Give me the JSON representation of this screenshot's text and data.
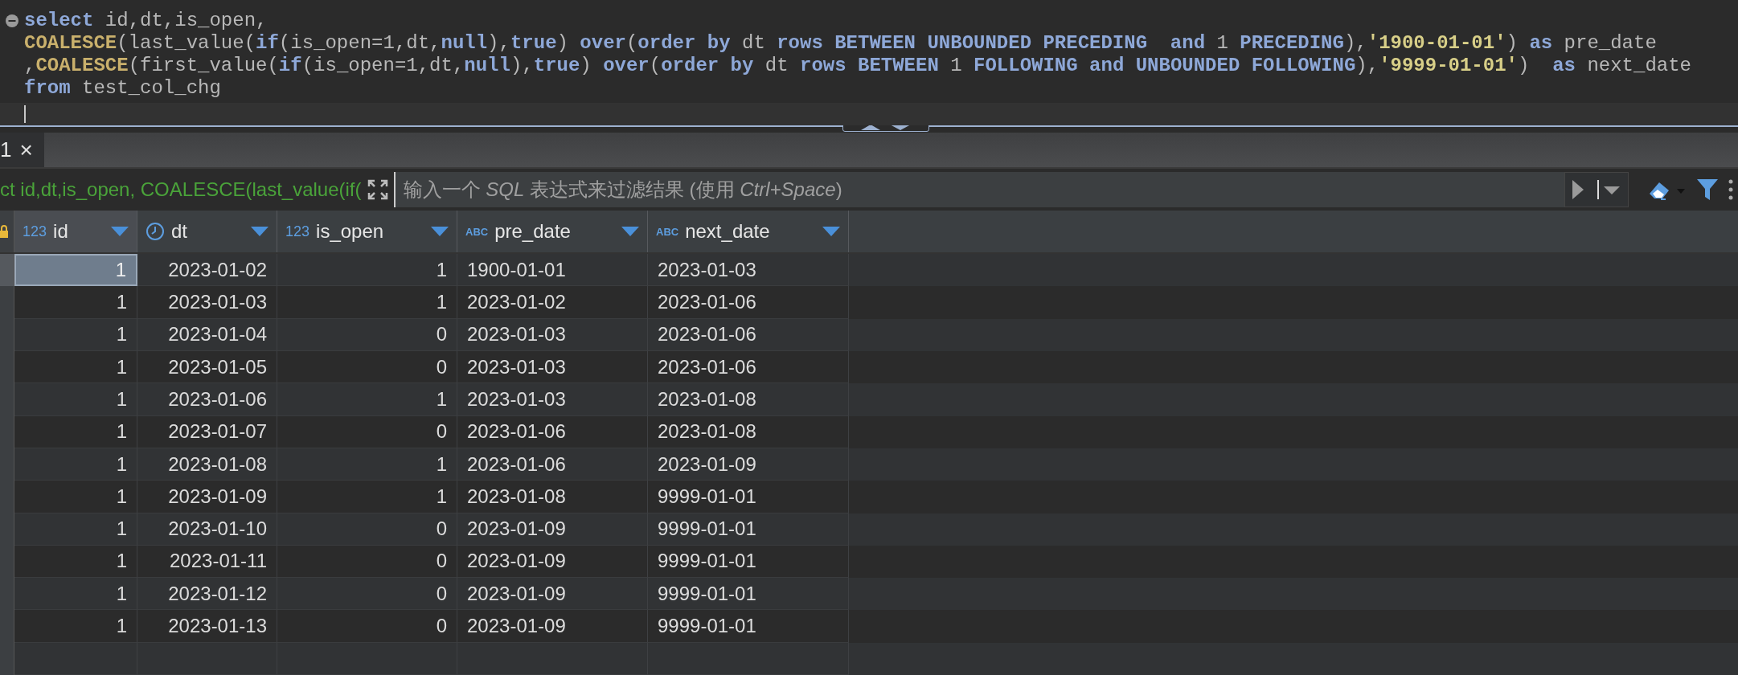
{
  "editor": {
    "lines": [
      [
        {
          "kind": "keyword",
          "text": "select"
        },
        {
          "kind": "plain",
          "text": " id,dt,is_open,"
        }
      ],
      [
        {
          "kind": "function",
          "text": "COALESCE"
        },
        {
          "kind": "plain",
          "text": "(last_value("
        },
        {
          "kind": "keyword",
          "text": "if"
        },
        {
          "kind": "plain",
          "text": "(is_open=1,dt,"
        },
        {
          "kind": "keyword",
          "text": "null"
        },
        {
          "kind": "plain",
          "text": "),"
        },
        {
          "kind": "keyword",
          "text": "true"
        },
        {
          "kind": "plain",
          "text": ") "
        },
        {
          "kind": "keyword",
          "text": "over"
        },
        {
          "kind": "plain",
          "text": "("
        },
        {
          "kind": "keyword",
          "text": "order by"
        },
        {
          "kind": "plain",
          "text": " dt "
        },
        {
          "kind": "keyword",
          "text": "rows BETWEEN UNBOUNDED PRECEDING  and"
        },
        {
          "kind": "plain",
          "text": " 1 "
        },
        {
          "kind": "keyword",
          "text": "PRECEDING"
        },
        {
          "kind": "plain",
          "text": "),"
        },
        {
          "kind": "string",
          "text": "'1900-01-01'"
        },
        {
          "kind": "plain",
          "text": ") "
        },
        {
          "kind": "keyword",
          "text": "as"
        },
        {
          "kind": "plain",
          "text": " pre_date"
        }
      ],
      [
        {
          "kind": "plain",
          "text": ","
        },
        {
          "kind": "function",
          "text": "COALESCE"
        },
        {
          "kind": "plain",
          "text": "(first_value("
        },
        {
          "kind": "keyword",
          "text": "if"
        },
        {
          "kind": "plain",
          "text": "(is_open=1,dt,"
        },
        {
          "kind": "keyword",
          "text": "null"
        },
        {
          "kind": "plain",
          "text": "),"
        },
        {
          "kind": "keyword",
          "text": "true"
        },
        {
          "kind": "plain",
          "text": ") "
        },
        {
          "kind": "keyword",
          "text": "over"
        },
        {
          "kind": "plain",
          "text": "("
        },
        {
          "kind": "keyword",
          "text": "order by"
        },
        {
          "kind": "plain",
          "text": " dt "
        },
        {
          "kind": "keyword",
          "text": "rows BETWEEN"
        },
        {
          "kind": "plain",
          "text": " 1 "
        },
        {
          "kind": "keyword",
          "text": "FOLLOWING and UNBOUNDED FOLLOWING"
        },
        {
          "kind": "plain",
          "text": "),"
        },
        {
          "kind": "string",
          "text": "'9999-01-01'"
        },
        {
          "kind": "plain",
          "text": ")  "
        },
        {
          "kind": "keyword",
          "text": "as"
        },
        {
          "kind": "plain",
          "text": " next_date"
        }
      ],
      [
        {
          "kind": "keyword",
          "text": "from"
        },
        {
          "kind": "plain",
          "text": " test_col_chg"
        }
      ]
    ]
  },
  "tabs": [
    {
      "label": "1",
      "close": "×",
      "selected": true
    }
  ],
  "filter": {
    "query": "ct id,dt,is_open, COALESCE(last_value(if(",
    "placeholder": "输入一个 *SQL* 表达式来过滤结果 (使用 *Ctrl+Space*)"
  },
  "table": {
    "columns": [
      {
        "name": "id",
        "kind": "number",
        "type_label": "123"
      },
      {
        "name": "dt",
        "kind": "datetime"
      },
      {
        "name": "is_open",
        "kind": "number",
        "type_label": "123"
      },
      {
        "name": "pre_date",
        "kind": "text",
        "type_label": "ABC"
      },
      {
        "name": "next_date",
        "kind": "text",
        "type_label": "ABC"
      }
    ],
    "rows": [
      {
        "selected": true,
        "cells": [
          "1",
          "2023-01-02",
          "1",
          "1900-01-01",
          "2023-01-03"
        ]
      },
      {
        "selected": false,
        "cells": [
          "1",
          "2023-01-03",
          "1",
          "2023-01-02",
          "2023-01-06"
        ]
      },
      {
        "selected": false,
        "cells": [
          "1",
          "2023-01-04",
          "0",
          "2023-01-03",
          "2023-01-06"
        ]
      },
      {
        "selected": false,
        "cells": [
          "1",
          "2023-01-05",
          "0",
          "2023-01-03",
          "2023-01-06"
        ]
      },
      {
        "selected": false,
        "cells": [
          "1",
          "2023-01-06",
          "1",
          "2023-01-03",
          "2023-01-08"
        ]
      },
      {
        "selected": false,
        "cells": [
          "1",
          "2023-01-07",
          "0",
          "2023-01-06",
          "2023-01-08"
        ]
      },
      {
        "selected": false,
        "cells": [
          "1",
          "2023-01-08",
          "1",
          "2023-01-06",
          "2023-01-09"
        ]
      },
      {
        "selected": false,
        "cells": [
          "1",
          "2023-01-09",
          "1",
          "2023-01-08",
          "9999-01-01"
        ]
      },
      {
        "selected": false,
        "cells": [
          "1",
          "2023-01-10",
          "0",
          "2023-01-09",
          "9999-01-01"
        ]
      },
      {
        "selected": false,
        "cells": [
          "1",
          "2023-01-11",
          "0",
          "2023-01-09",
          "9999-01-01"
        ]
      },
      {
        "selected": false,
        "cells": [
          "1",
          "2023-01-12",
          "0",
          "2023-01-09",
          "9999-01-01"
        ]
      },
      {
        "selected": false,
        "cells": [
          "1",
          "2023-01-13",
          "0",
          "2023-01-09",
          "9999-01-01"
        ]
      }
    ]
  }
}
